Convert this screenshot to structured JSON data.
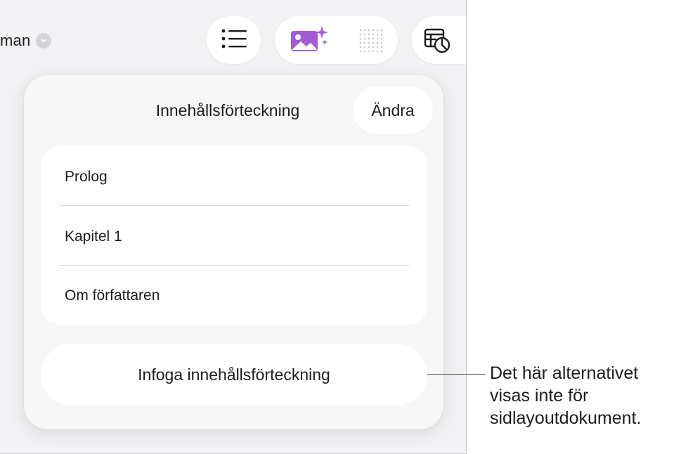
{
  "document": {
    "title_fragment": "man"
  },
  "toolbar": {
    "list_icon": "bulleted-list-icon",
    "media_icon": "image-sparkle-icon",
    "grid_icon": "dot-grid-icon",
    "table_chart_icon": "table-chart-icon"
  },
  "popover": {
    "title": "Innehållsförteckning",
    "edit_label": "Ändra",
    "items": [
      {
        "label": "Prolog"
      },
      {
        "label": "Kapitel 1"
      },
      {
        "label": "Om författaren"
      }
    ],
    "insert_label": "Infoga innehållsförteckning"
  },
  "callout": {
    "line1": "Det här alternativet",
    "line2": "visas inte för",
    "line3": "sidlayoutdokument."
  },
  "colors": {
    "accent": "#a45cd6",
    "background": "#f2f2f4",
    "panel": "#ffffff"
  }
}
